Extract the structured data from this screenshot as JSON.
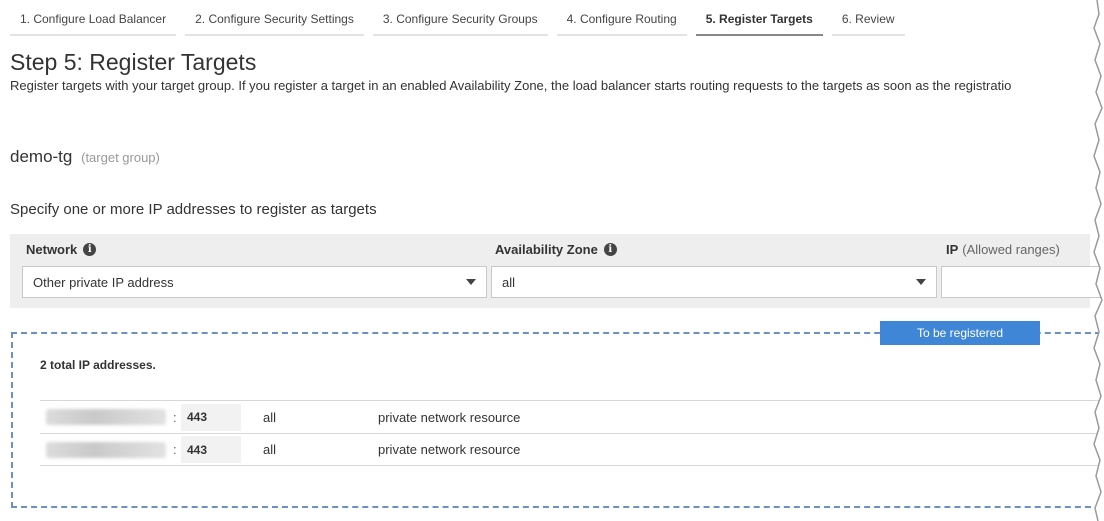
{
  "steps": [
    {
      "label": "1. Configure Load Balancer",
      "active": false
    },
    {
      "label": "2. Configure Security Settings",
      "active": false
    },
    {
      "label": "3. Configure Security Groups",
      "active": false
    },
    {
      "label": "4. Configure Routing",
      "active": false
    },
    {
      "label": "5. Register Targets",
      "active": true
    },
    {
      "label": "6. Review",
      "active": false
    }
  ],
  "page": {
    "title": "Step 5: Register Targets",
    "description": "Register targets with your target group. If you register a target in an enabled Availability Zone, the load balancer starts routing requests to the targets as soon as the registratio"
  },
  "target_group": {
    "name": "demo-tg",
    "label": "(target group)"
  },
  "specify_text": "Specify one or more IP addresses to register as targets",
  "filters": {
    "network_label": "Network",
    "network_value": "Other private IP address",
    "az_label": "Availability Zone",
    "az_value": "all",
    "ip_label": "IP",
    "ip_sub": "(Allowed ranges)",
    "info_glyph": "i"
  },
  "registered": {
    "badge": "To be registered",
    "total": "2 total IP addresses.",
    "colon": ":",
    "rows": [
      {
        "port": "443",
        "az": "all",
        "resource": "private network resource"
      },
      {
        "port": "443",
        "az": "all",
        "resource": "private network resource"
      }
    ]
  },
  "colors": {
    "accent": "#3f87d6",
    "dashed_border": "#6b8fc6",
    "panel_bg": "#eeeeee"
  }
}
